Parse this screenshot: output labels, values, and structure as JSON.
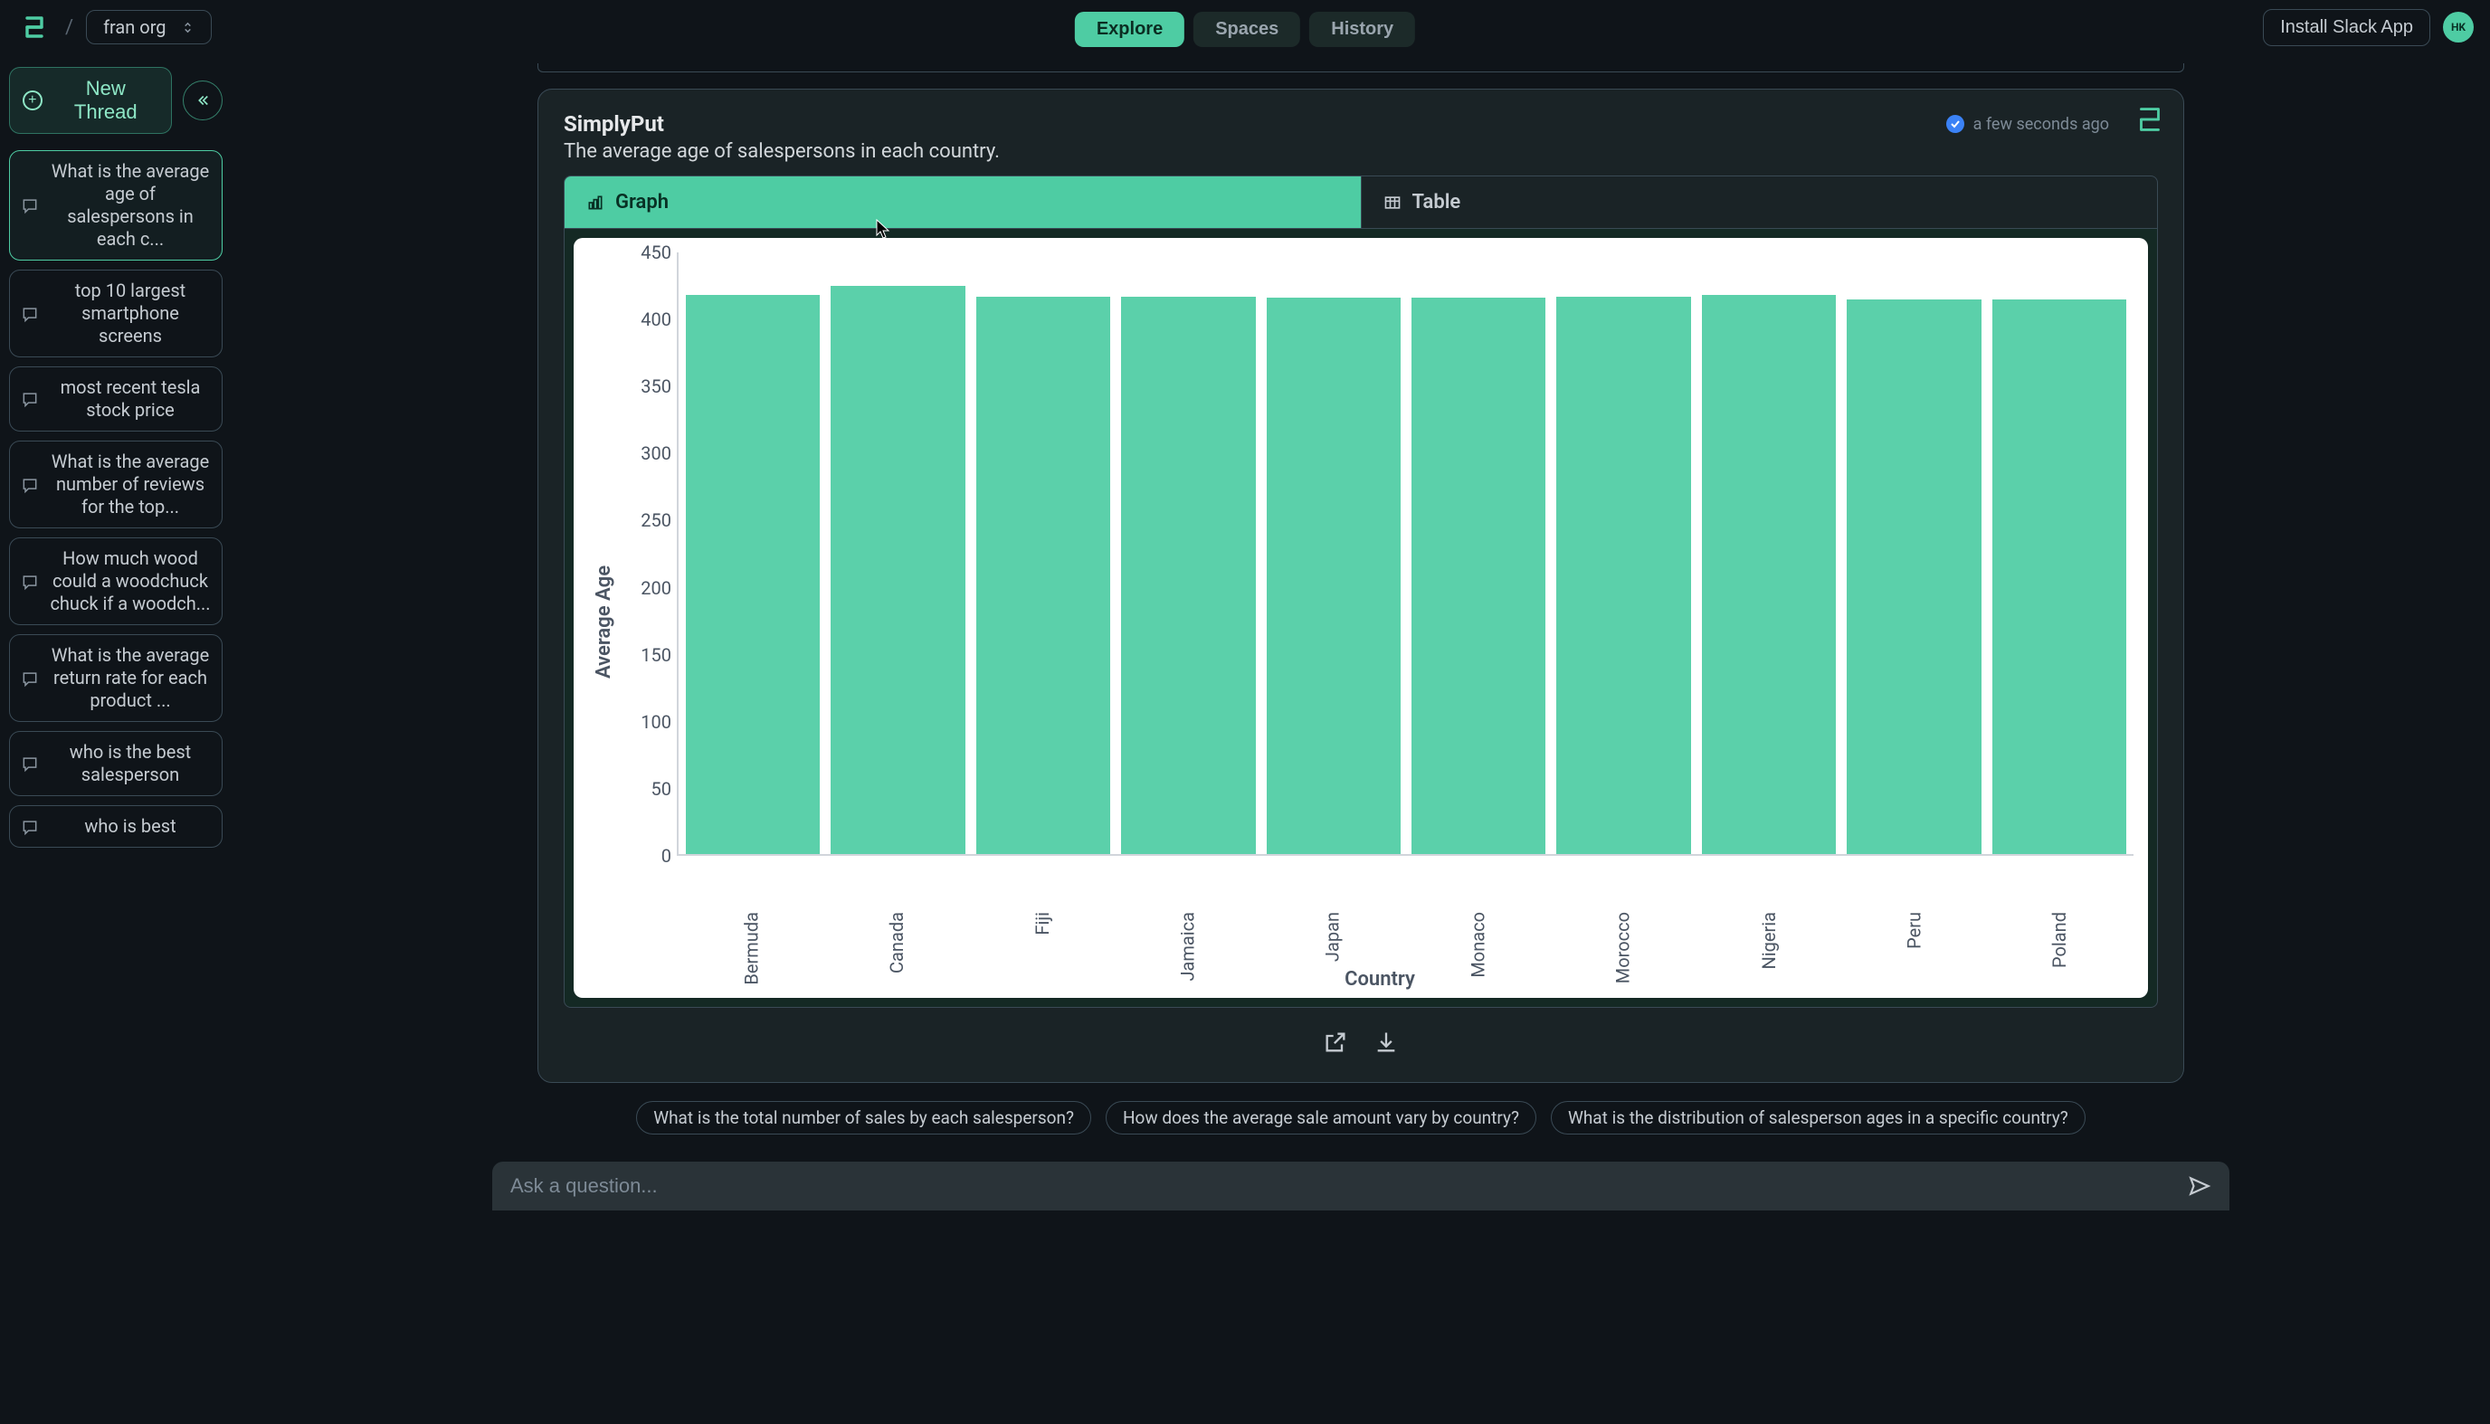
{
  "header": {
    "org": "fran org",
    "tabs": {
      "explore": "Explore",
      "spaces": "Spaces",
      "history": "History"
    },
    "slack": "Install Slack App",
    "avatar": "HK"
  },
  "sidebar": {
    "new_thread": "New Thread",
    "threads": [
      "What is the average age of salespersons in each c...",
      "top 10 largest smartphone screens",
      "most recent tesla stock price",
      "What is the average number of reviews for the top...",
      "How much wood could a woodchuck chuck if a woodch...",
      "What is the average return rate for each product ...",
      "who is the best salesperson",
      "who is best"
    ]
  },
  "answer": {
    "bot": "SimplyPut",
    "timestamp": "a few seconds ago",
    "description": "The average age of salespersons in each country.",
    "tabs": {
      "graph": "Graph",
      "table": "Table"
    },
    "xlabel": "Country",
    "ylabel": "Average Age"
  },
  "suggestions": [
    "What is the total number of sales by each salesperson?",
    "How does the average sale amount vary by country?",
    "What is the distribution of salesperson ages in a specific country?"
  ],
  "input": {
    "placeholder": "Ask a question..."
  },
  "chart_data": {
    "type": "bar",
    "categories": [
      "Bermuda",
      "Canada",
      "Fiji",
      "Jamaica",
      "Japan",
      "Monaco",
      "Morocco",
      "Nigeria",
      "Peru",
      "Poland"
    ],
    "values": [
      418,
      425,
      417,
      417,
      416,
      416,
      417,
      418,
      415,
      415
    ],
    "title": "",
    "xlabel": "Country",
    "ylabel": "Average Age",
    "ylim": [
      0,
      450
    ],
    "yticks": [
      0.0,
      50,
      100,
      150,
      200,
      250,
      300,
      350,
      400,
      450
    ]
  }
}
